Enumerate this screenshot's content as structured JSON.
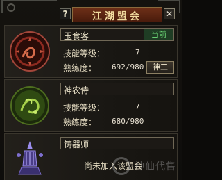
{
  "window": {
    "title": "江湖盟会",
    "help_label": "?",
    "close_label": "✕"
  },
  "guilds": [
    {
      "name": "玉食客",
      "status": "当前",
      "skill_level_label": "技能等级：",
      "skill_level": "7",
      "proficiency_label": "熟练度：",
      "proficiency": "692/980",
      "action_label": "神工",
      "emblem_icon": "jade-gourmet-emblem-icon",
      "accent_color": "#8a2a22"
    },
    {
      "name": "神农侍",
      "skill_level_label": "技能等级：",
      "skill_level": "7",
      "proficiency_label": "熟练度：",
      "proficiency": "680/980",
      "emblem_icon": "shennong-emblem-icon",
      "accent_color": "#5b7f24"
    },
    {
      "name": "铸器师",
      "message": "尚未加入该盟会",
      "emblem_icon": "smith-emblem-icon",
      "accent_color": "#4a3d88"
    }
  ]
}
